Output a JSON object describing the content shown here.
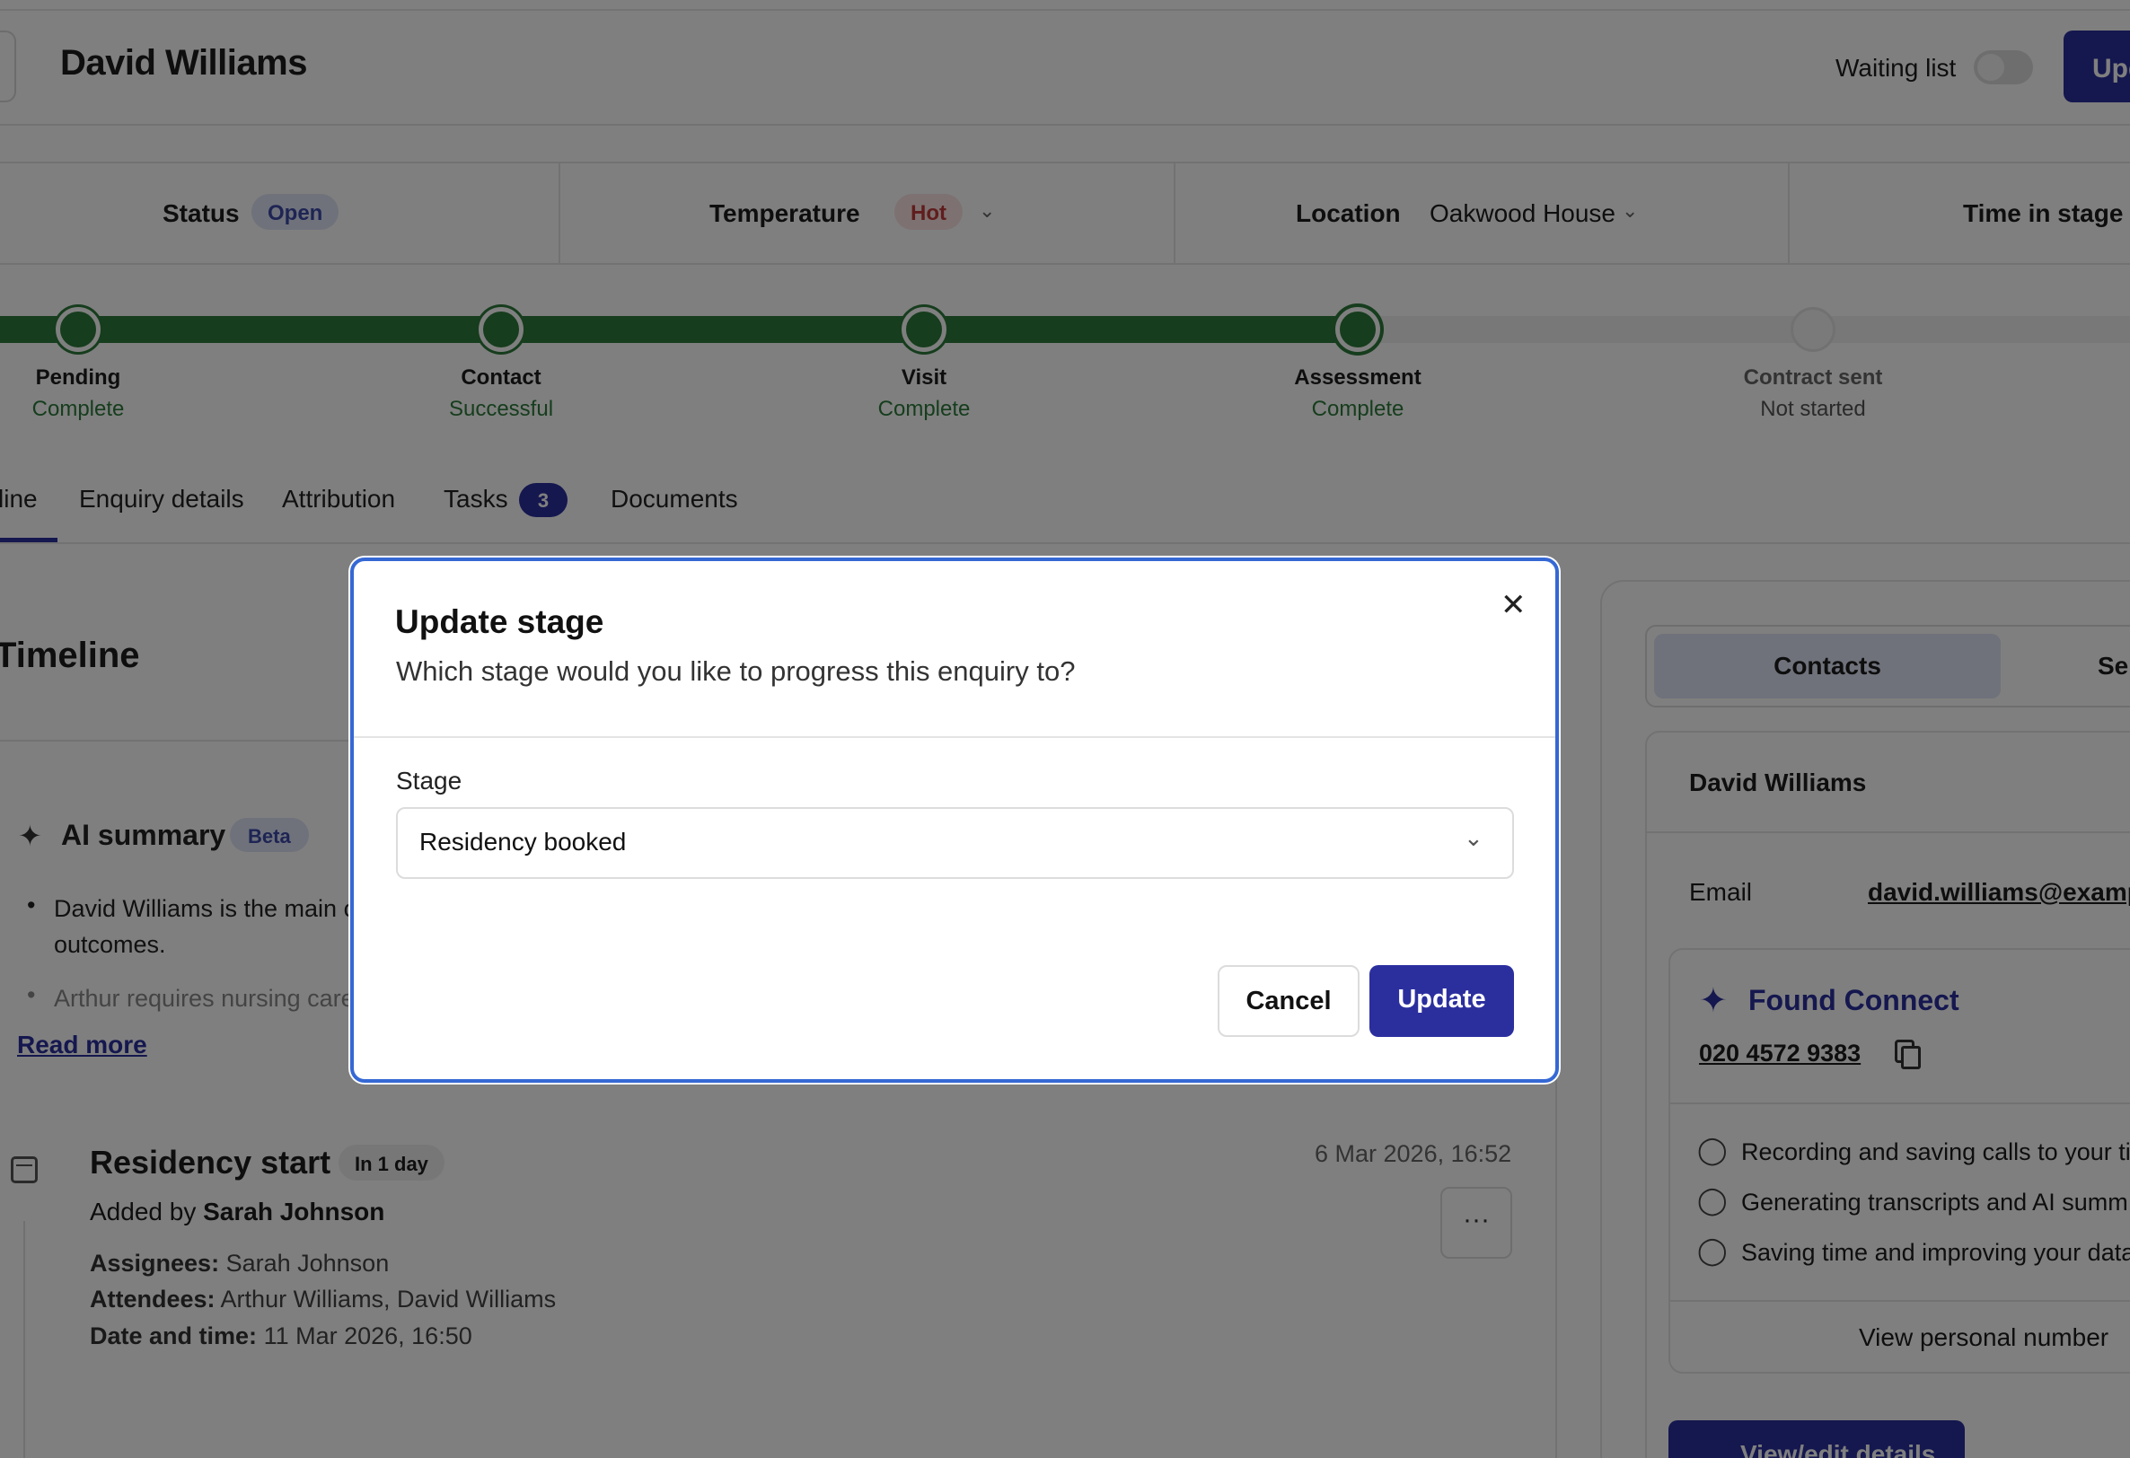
{
  "header": {
    "title": "David Williams",
    "waiting_list_label": "Waiting list",
    "update_button_label": "Upd"
  },
  "info": {
    "status_label": "Status",
    "status_value": "Open",
    "temperature_label": "Temperature",
    "temperature_value": "Hot",
    "location_label": "Location",
    "location_value": "Oakwood House",
    "time_in_stage_label": "Time in stage"
  },
  "stages": [
    {
      "name": "Pending",
      "state": "Complete"
    },
    {
      "name": "Contact",
      "state": "Successful"
    },
    {
      "name": "Visit",
      "state": "Complete"
    },
    {
      "name": "Assessment",
      "state": "Complete"
    },
    {
      "name": "Contract sent",
      "state": "Not started"
    }
  ],
  "tabs": {
    "timeline": "line",
    "enquiry_details": "Enquiry details",
    "attribution": "Attribution",
    "tasks": "Tasks",
    "tasks_count": "3",
    "documents": "Documents"
  },
  "timeline": {
    "title": "Timeline",
    "ai_summary_title": "AI summary",
    "ai_summary_badge": "Beta",
    "bullet_1_line_1": "David Williams is the main c",
    "bullet_1_line_2": "outcomes.",
    "bullet_2": "Arthur requires nursing care",
    "read_more": "Read more",
    "event": {
      "title": "Residency start",
      "badge": "In 1 day",
      "date": "6 Mar 2026, 16:52",
      "added_by_prefix": "Added by",
      "added_by_name": "Sarah Johnson",
      "assignees_label": "Assignees:",
      "assignees_value": "Sarah Johnson",
      "attendees_label": "Attendees:",
      "attendees_value": "Arthur Williams, David Williams",
      "datetime_label": "Date and time:",
      "datetime_value": "11 Mar 2026, 16:50",
      "more_button": "···"
    }
  },
  "right_panel": {
    "tab_contacts": "Contacts",
    "tab_other": "Se",
    "contact_name": "David Williams",
    "email_label": "Email",
    "email_value": "david.williams@examp",
    "found_connect": {
      "title": "Found Connect",
      "phone": "020 4572 9383",
      "items": [
        "Recording and saving calls to your ti",
        "Generating transcripts and AI summ",
        "Saving time and improving your data"
      ],
      "view_personal": "View personal number"
    },
    "view_edit_button": "View/edit details"
  },
  "modal": {
    "title": "Update stage",
    "subtitle": "Which stage would you like to progress this enquiry to?",
    "stage_label": "Stage",
    "stage_value": "Residency booked",
    "cancel_label": "Cancel",
    "update_label": "Update"
  },
  "colors": {
    "brand": "#2b2f9e",
    "progress_complete": "#2c7a3b",
    "modal_border": "#3568d4"
  }
}
